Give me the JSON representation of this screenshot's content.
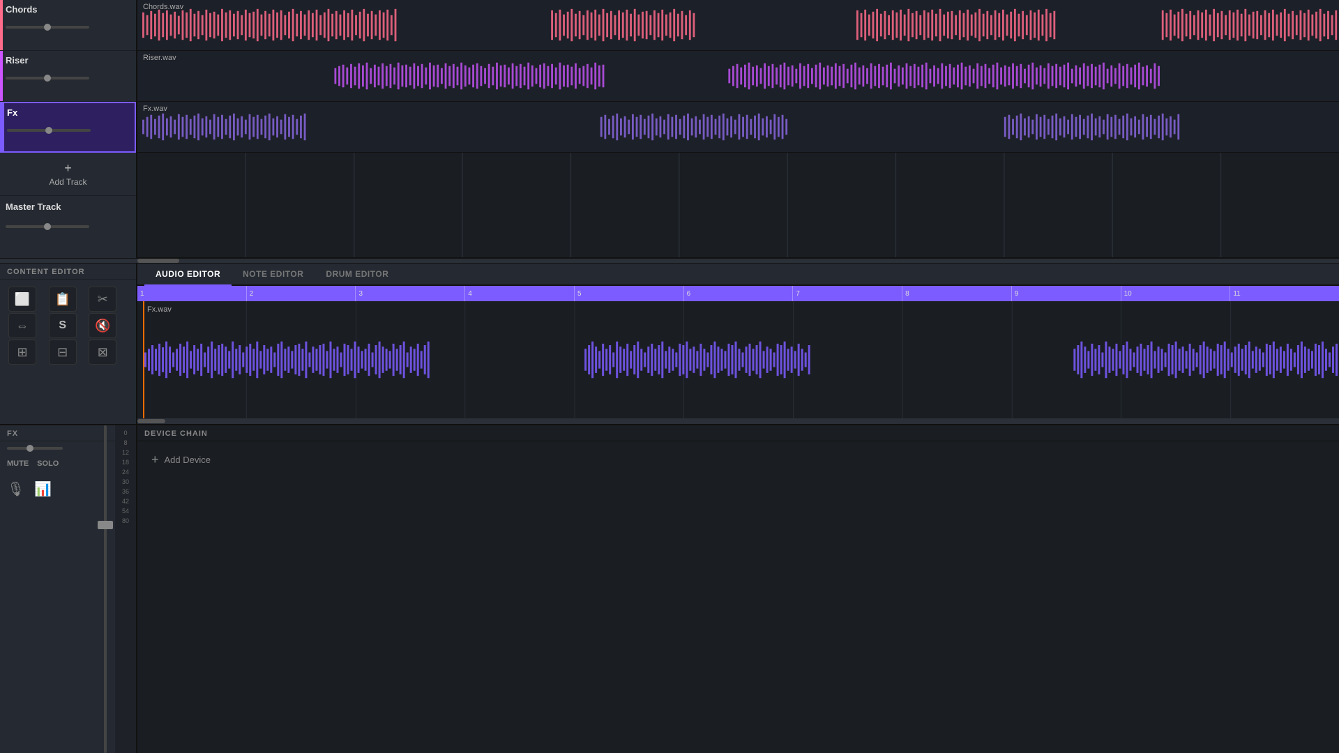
{
  "tracks": [
    {
      "id": "chords",
      "name": "Chords",
      "file": "Chords.wav",
      "color": "#ff6b8a",
      "sliderVal": 50
    },
    {
      "id": "riser",
      "name": "Riser",
      "file": "Riser.wav",
      "color": "#cc55ff",
      "sliderVal": 50
    },
    {
      "id": "fx",
      "name": "Fx",
      "file": "Fx.wav",
      "color": "#7c5cff",
      "sliderVal": 50,
      "active": true
    }
  ],
  "addTrack": {
    "label": "Add Track"
  },
  "masterTrack": {
    "name": "Master Track"
  },
  "contentEditor": {
    "title": "CONTENT EDITOR",
    "tools": [
      "⬜",
      "📋",
      "✂️",
      "↔",
      "S",
      "🔇",
      "⊞",
      "⊟",
      "⊠"
    ]
  },
  "editorTabs": [
    {
      "id": "audio",
      "label": "AUDIO EDITOR",
      "active": true
    },
    {
      "id": "note",
      "label": "NOTE EDITOR",
      "active": false
    },
    {
      "id": "drum",
      "label": "DRUM EDITOR",
      "active": false
    }
  ],
  "audioEditor": {
    "file": "Fx.wav",
    "rulerMarks": [
      "1",
      "2",
      "3",
      "4",
      "5",
      "6",
      "7",
      "8",
      "9",
      "10",
      "11"
    ]
  },
  "fx": {
    "title": "FX",
    "mute": "MUTE",
    "solo": "SOLO",
    "dbLabels": [
      "0",
      "8",
      "12",
      "18",
      "24",
      "30",
      "36",
      "42",
      "54",
      "80"
    ]
  },
  "deviceChain": {
    "title": "DEVICE CHAIN",
    "addDevice": "Add Device"
  }
}
